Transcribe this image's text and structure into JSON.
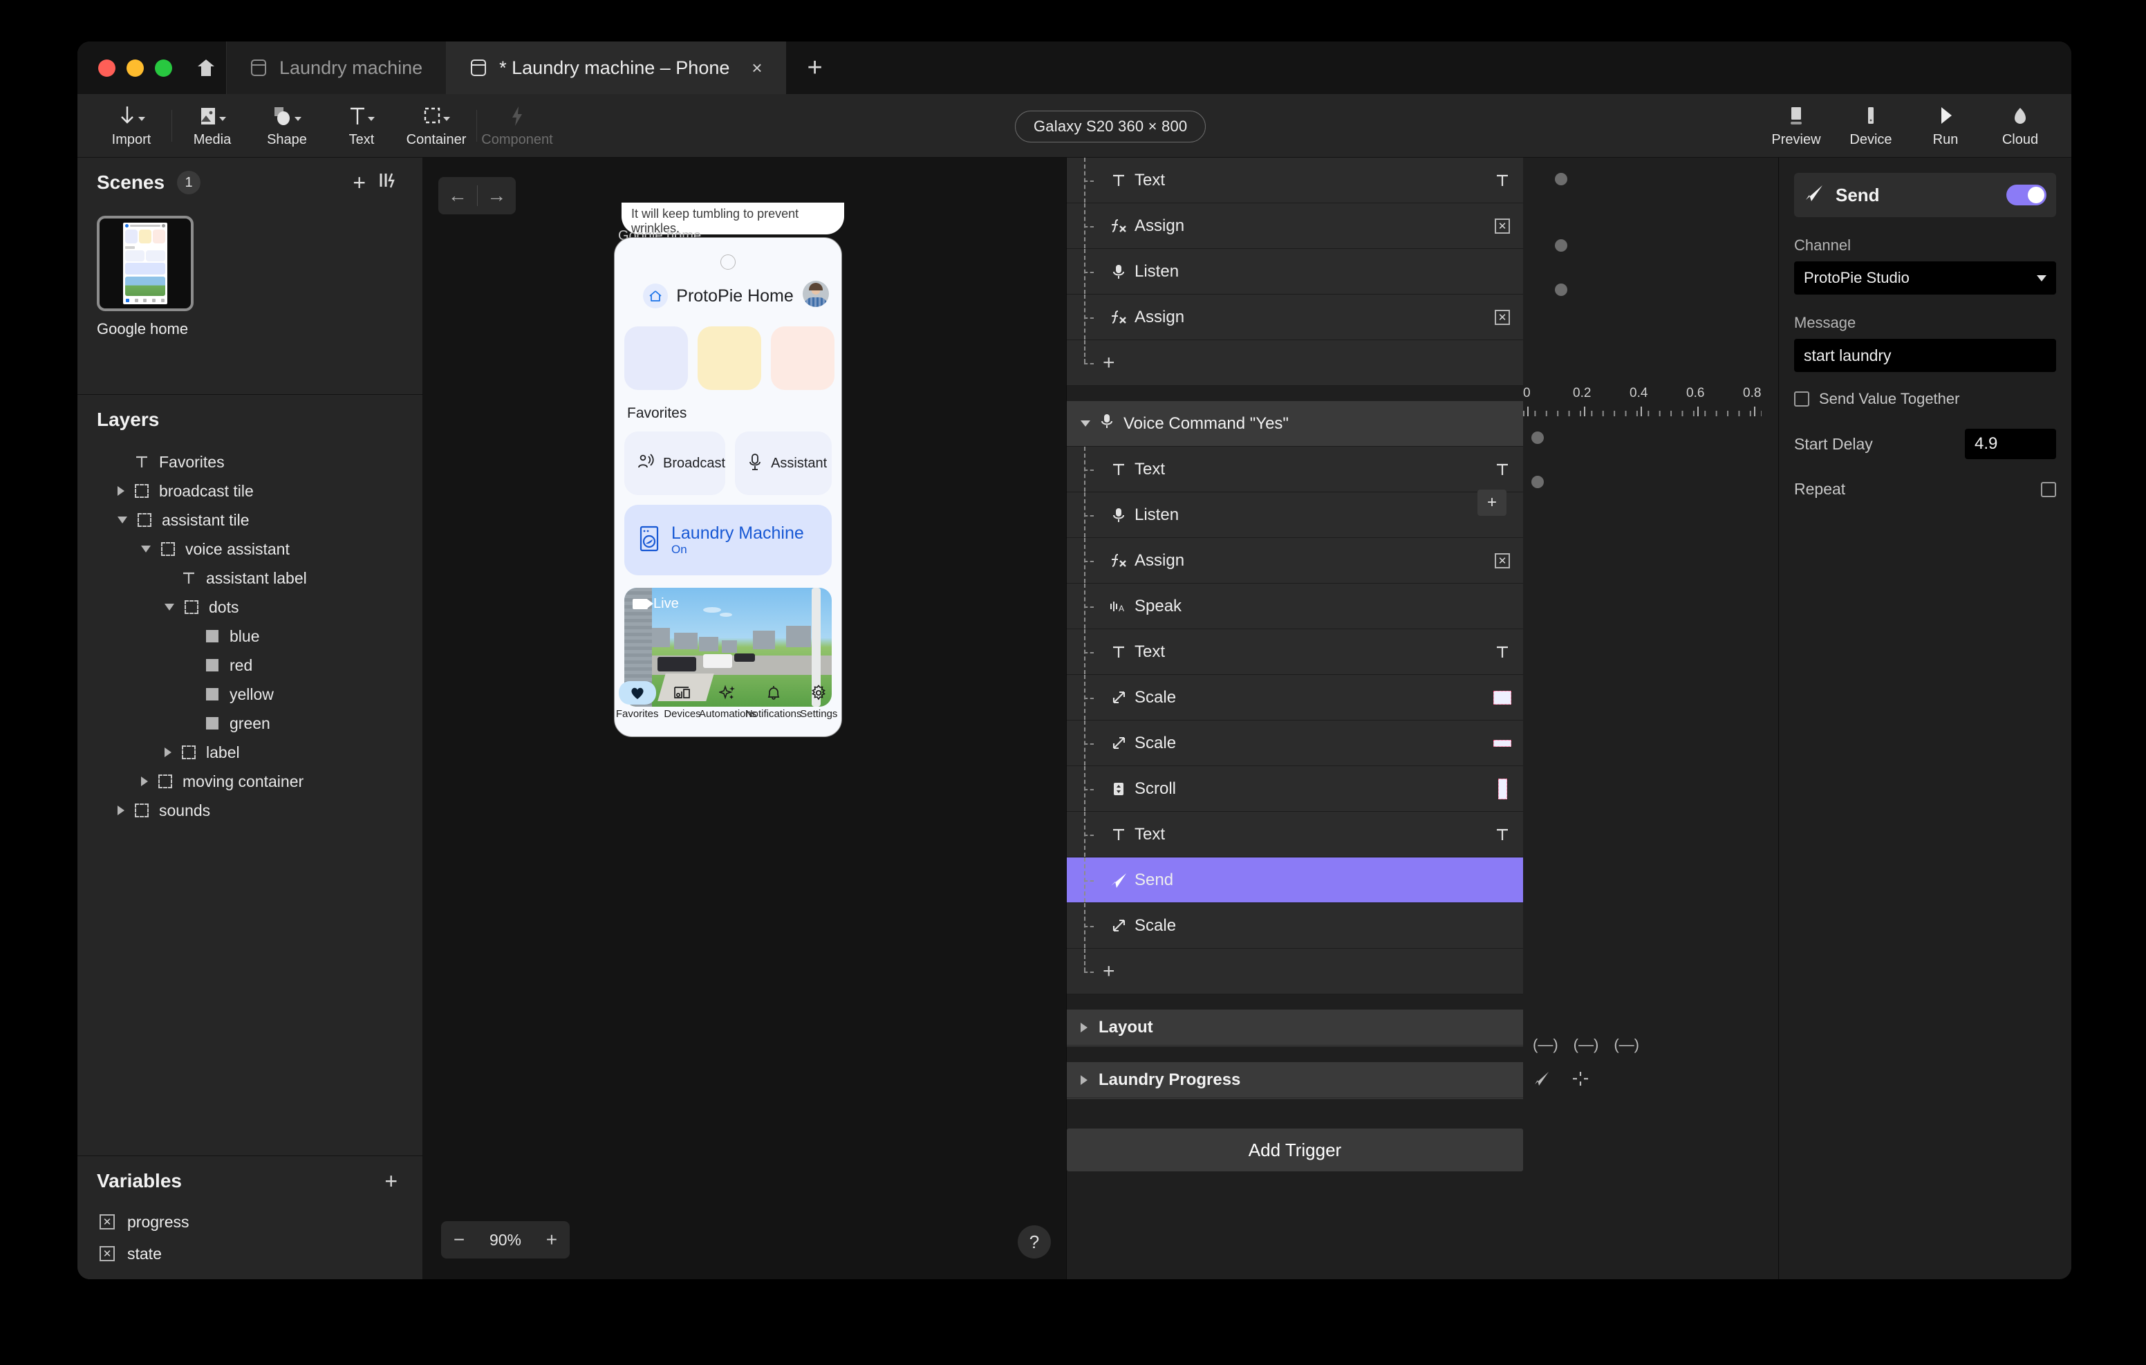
{
  "window": {
    "tabs": [
      {
        "label": "Laundry machine",
        "active": false,
        "closable": false
      },
      {
        "label": "* Laundry machine – Phone",
        "active": true,
        "closable": true,
        "close_label": "×"
      }
    ],
    "new_tab_label": "+"
  },
  "toolbar": {
    "tools": [
      {
        "label": "Import",
        "icon": "import-arrow-icon",
        "has_caret": true,
        "disabled": false
      },
      {
        "label": "Media",
        "icon": "media-image-icon",
        "has_caret": true,
        "disabled": false
      },
      {
        "label": "Shape",
        "icon": "shape-icon",
        "has_caret": true,
        "disabled": false
      },
      {
        "label": "Text",
        "icon": "text-t-icon",
        "has_caret": true,
        "disabled": false
      },
      {
        "label": "Container",
        "icon": "container-dashed-icon",
        "has_caret": true,
        "disabled": false
      },
      {
        "label": "Component",
        "icon": "component-bolt-icon",
        "has_caret": false,
        "disabled": true
      }
    ],
    "device_pill": "Galaxy S20  360 × 800",
    "right_actions": [
      {
        "label": "Preview",
        "icon": "preview-screen-icon"
      },
      {
        "label": "Device",
        "icon": "device-phone-icon"
      },
      {
        "label": "Run",
        "icon": "run-play-icon"
      },
      {
        "label": "Cloud",
        "icon": "cloud-icon"
      }
    ]
  },
  "scenes": {
    "title": "Scenes",
    "count": "1",
    "add_label": "+",
    "items": [
      {
        "name": "Google home",
        "selected": true
      }
    ]
  },
  "layers": {
    "title": "Layers",
    "items": [
      {
        "label": "Favorites",
        "depth": 1,
        "icon": "text-layer-icon",
        "arrow": "none"
      },
      {
        "label": "broadcast tile",
        "depth": 1,
        "icon": "container-layer-icon",
        "arrow": "closed"
      },
      {
        "label": "assistant tile",
        "depth": 1,
        "icon": "container-layer-icon",
        "arrow": "open"
      },
      {
        "label": "voice assistant",
        "depth": 2,
        "icon": "container-layer-icon",
        "arrow": "open"
      },
      {
        "label": "assistant label",
        "depth": 3,
        "icon": "text-layer-icon",
        "arrow": "none"
      },
      {
        "label": "dots",
        "depth": 3,
        "icon": "container-layer-icon",
        "arrow": "open"
      },
      {
        "label": "blue",
        "depth": 4,
        "icon": "shape-layer-icon",
        "arrow": "none"
      },
      {
        "label": "red",
        "depth": 4,
        "icon": "shape-layer-icon",
        "arrow": "none"
      },
      {
        "label": "yellow",
        "depth": 4,
        "icon": "shape-layer-icon",
        "arrow": "none"
      },
      {
        "label": "green",
        "depth": 4,
        "icon": "shape-layer-icon",
        "arrow": "none"
      },
      {
        "label": "label",
        "depth": 3,
        "icon": "container-layer-icon",
        "arrow": "closed"
      },
      {
        "label": "moving container",
        "depth": 2,
        "icon": "container-layer-icon",
        "arrow": "closed"
      },
      {
        "label": "sounds",
        "depth": 1,
        "icon": "container-layer-icon",
        "arrow": "closed"
      }
    ]
  },
  "variables": {
    "title": "Variables",
    "add_label": "+",
    "items": [
      {
        "name": "progress"
      },
      {
        "name": "state"
      }
    ]
  },
  "canvas": {
    "nav_back": "←",
    "nav_forward": "→",
    "ghost_card_text": "It will keep tumbling to prevent wrinkles.",
    "ghost_label": "Google home",
    "zoom_minus": "−",
    "zoom_value": "90%",
    "zoom_plus": "+",
    "help_label": "?"
  },
  "phone_preview": {
    "app_title": "ProtoPie Home",
    "chevron": "⌄",
    "swatches": [
      "#e6eafb",
      "#fbeec3",
      "#fdeae3",
      "#dcf0dc"
    ],
    "section_title": "Favorites",
    "tiles": [
      {
        "label": "Broadcast",
        "icon": "broadcast-person-icon"
      },
      {
        "label": "Assistant",
        "icon": "microphone-icon"
      }
    ],
    "laundry": {
      "title": "Laundry Machine",
      "status": "On",
      "icon": "washing-machine-icon"
    },
    "camera": {
      "badge": "Live",
      "icon": "video-camera-icon"
    },
    "nav": [
      {
        "label": "Favorites",
        "icon": "heart-icon",
        "selected": true
      },
      {
        "label": "Devices",
        "icon": "devices-icon",
        "selected": false
      },
      {
        "label": "Automations",
        "icon": "sparkles-icon",
        "selected": false
      },
      {
        "label": "Notifications",
        "icon": "bell-icon",
        "selected": false
      },
      {
        "label": "Settings",
        "icon": "gear-icon",
        "selected": false
      }
    ]
  },
  "interaction": {
    "partial_top_trigger": {
      "actions": [
        {
          "label": "Text",
          "icon": "text-action-icon",
          "right": "text-t-icon"
        },
        {
          "label": "Assign",
          "icon": "assign-fx-icon",
          "right": "variable-x-icon"
        },
        {
          "label": "Listen",
          "icon": "microphone-icon",
          "right": ""
        },
        {
          "label": "Assign",
          "icon": "assign-fx-icon",
          "right": "variable-x-icon"
        }
      ],
      "add_label": "+"
    },
    "trigger": {
      "name": "Voice Command \"Yes\"",
      "icon": "microphone-icon",
      "actions": [
        {
          "label": "Text",
          "icon": "text-action-icon",
          "right": "text-t-icon",
          "selected": false
        },
        {
          "label": "Listen",
          "icon": "microphone-icon",
          "right": "",
          "selected": false
        },
        {
          "label": "Assign",
          "icon": "assign-fx-icon",
          "right": "variable-x-icon",
          "selected": false
        },
        {
          "label": "Speak",
          "icon": "speak-wave-icon",
          "right": "",
          "selected": false
        },
        {
          "label": "Text",
          "icon": "text-action-icon",
          "right": "text-t-icon",
          "selected": false
        },
        {
          "label": "Scale",
          "icon": "scale-arrow-icon",
          "right": "layer-chip-square",
          "selected": false
        },
        {
          "label": "Scale",
          "icon": "scale-arrow-icon",
          "right": "layer-chip-thin",
          "selected": false
        },
        {
          "label": "Scroll",
          "icon": "scroll-icon",
          "right": "layer-chip-tall",
          "selected": false
        },
        {
          "label": "Text",
          "icon": "text-action-icon",
          "right": "text-t-icon",
          "selected": false
        },
        {
          "label": "Send",
          "icon": "send-paperplane-icon",
          "right": "",
          "selected": true
        },
        {
          "label": "Scale",
          "icon": "scale-arrow-icon",
          "right": "",
          "selected": false
        }
      ],
      "add_label": "+"
    },
    "collapsed_sections": [
      {
        "label": "Layout"
      },
      {
        "label": "Laundry Progress"
      }
    ],
    "add_trigger_label": "Add Trigger",
    "timeline": {
      "tick_labels": [
        "0",
        "0.2",
        "0.4",
        "0.6",
        "0.8"
      ]
    }
  },
  "properties": {
    "title": "Send",
    "icon": "send-paperplane-icon",
    "enabled": true,
    "channel_label": "Channel",
    "channel_value": "ProtoPie Studio",
    "message_label": "Message",
    "message_value": "start laundry",
    "send_value_together_label": "Send Value Together",
    "send_value_together_checked": false,
    "start_delay_label": "Start Delay",
    "start_delay_value": "4.9",
    "repeat_label": "Repeat",
    "repeat_checked": false
  },
  "colors": {
    "accent": "#8b7bf6",
    "panel_bg": "#1f1f1f",
    "toolbar_bg": "#262626",
    "row_bg": "#2c2c2c",
    "brand_blue": "#1758d4"
  }
}
